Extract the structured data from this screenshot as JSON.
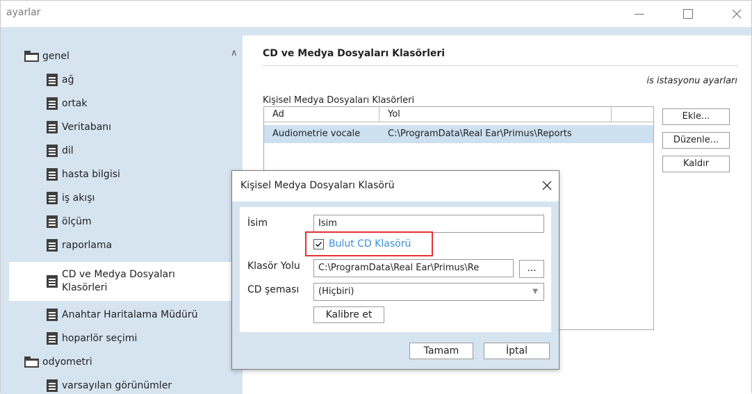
{
  "window": {
    "title": "ayarlar"
  },
  "tree": {
    "items": [
      {
        "label": "genel",
        "type": "folder"
      },
      {
        "label": "ağ",
        "type": "doc"
      },
      {
        "label": "ortak",
        "type": "doc"
      },
      {
        "label": "Veritabanı",
        "type": "doc"
      },
      {
        "label": "dil",
        "type": "doc"
      },
      {
        "label": "hasta bilgisi",
        "type": "doc"
      },
      {
        "label": "iş akışı",
        "type": "doc"
      },
      {
        "label": "ölçüm",
        "type": "doc"
      },
      {
        "label": "raporlama",
        "type": "doc"
      },
      {
        "label_line1": "CD ve Medya Dosyaları",
        "label_line2": "Klasörleri",
        "type": "doc",
        "selected": true
      },
      {
        "label": "Anahtar Haritalama Müdürü",
        "type": "doc"
      },
      {
        "label": "hoparlör seçimi",
        "type": "doc"
      },
      {
        "label": "odyometri",
        "type": "folder"
      },
      {
        "label": "varsayılan görünümler",
        "type": "doc"
      }
    ]
  },
  "panel": {
    "title": "CD ve Medya Dosyaları Klasörleri",
    "scope": "is istasyonu ayarları",
    "list_label": "Kişisel Medya Dosyaları Klasörleri",
    "columns": [
      "Ad",
      "Yol"
    ],
    "rows": [
      {
        "ad": "Audiometrie vocale",
        "yol": "C:\\ProgramData\\Real Ear\\Primus\\Reports"
      }
    ],
    "buttons": {
      "add": "Ekle...",
      "edit": "Düzenle...",
      "remove": "Kaldır"
    }
  },
  "dialog": {
    "title": "Kişisel Medya Dosyaları Klasörü",
    "name_label": "İsim",
    "name_value": "Isim",
    "cloud_checkbox": {
      "label": "Bulut CD Klasörü",
      "checked": true
    },
    "path_label": "Klasör Yolu",
    "path_value": "C:\\ProgramData\\Real Ear\\Primus\\Re",
    "browse_label": "...",
    "scheme_label": "CD şeması",
    "scheme_value": "(Hiçbiri)",
    "calibrate_label": "Kalibre et",
    "ok_label": "Tamam",
    "cancel_label": "İptal"
  },
  "colors": {
    "accent_link": "#3b8fd6",
    "highlight": "#e53030",
    "panel_bg": "#d6e4f0"
  }
}
